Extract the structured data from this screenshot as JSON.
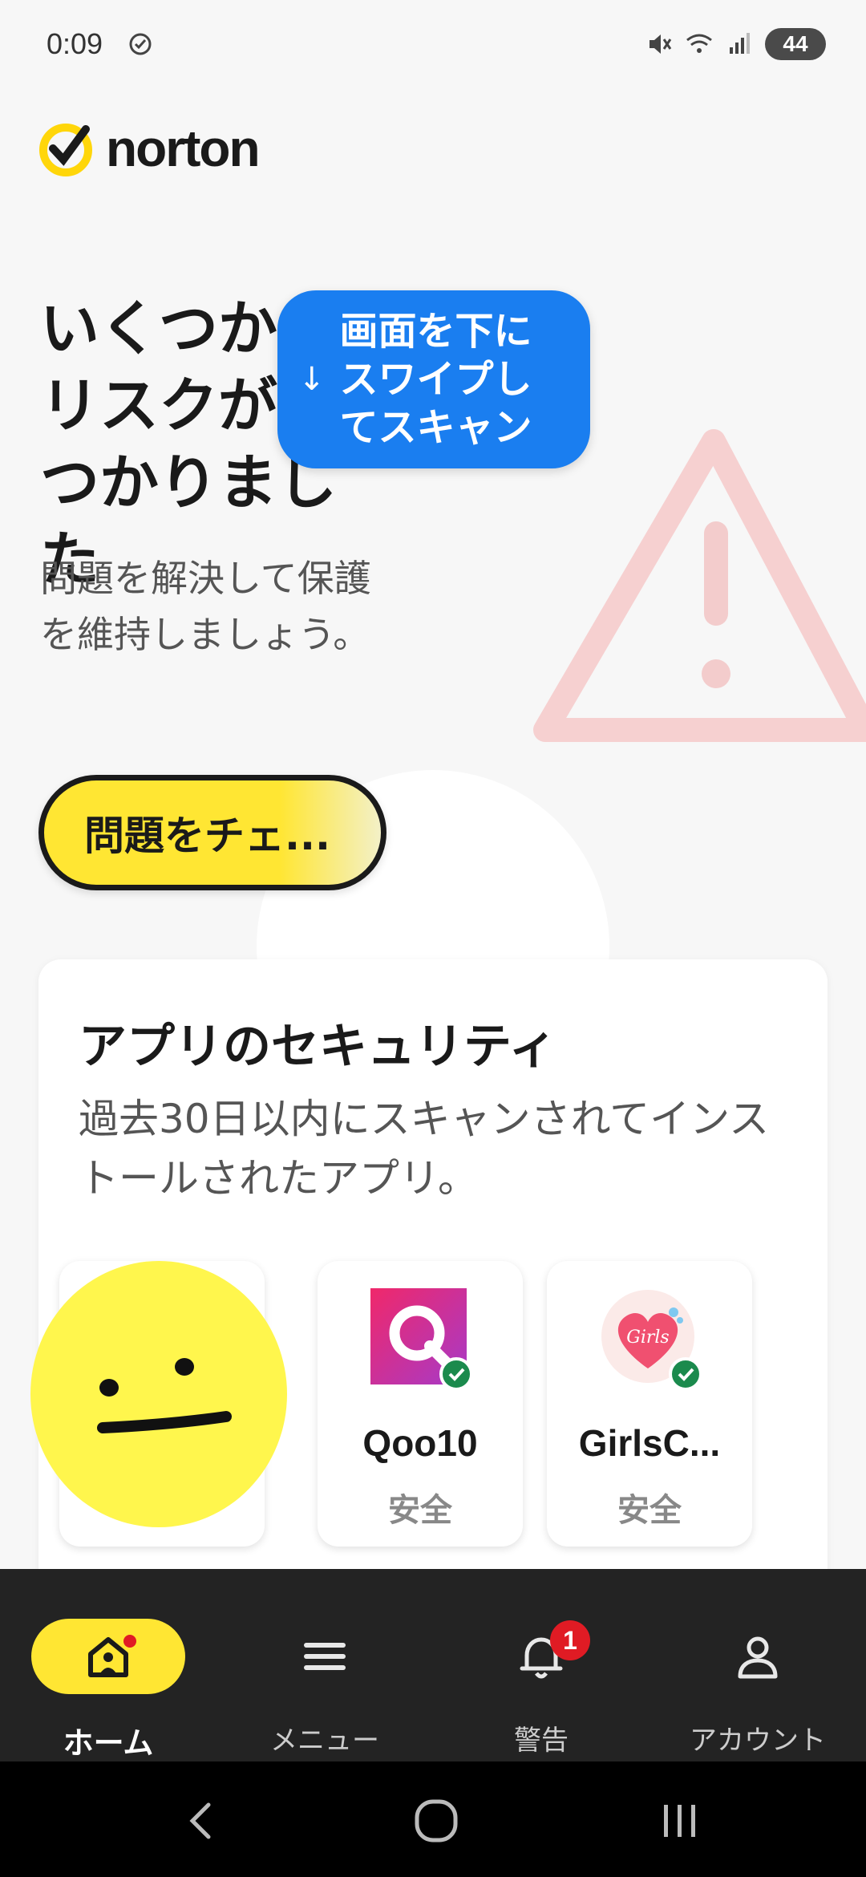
{
  "status_bar": {
    "time": "0:09",
    "battery": "44"
  },
  "brand": {
    "name": "norton"
  },
  "hero": {
    "title": "いくつかのリスクが見つかりました",
    "subtitle": "問題を解決して保護を維持しましょう。",
    "check_button_label": "問題をチェ..."
  },
  "swipe_tooltip": {
    "text": "画面を下に\nスワイプし\nてスキャン"
  },
  "app_security": {
    "title": "アプリのセキュリティ",
    "description": "過去30日以内にスキャンされてインストールされたアプリ。",
    "apps": [
      {
        "name": "Qoo10",
        "status": "安全",
        "icon": "qoo10-app-icon",
        "icon_color": "#e5246f"
      },
      {
        "name": "GirlsC...",
        "status": "安全",
        "icon": "girls-heart-app-icon",
        "icon_color": "#f05070"
      }
    ]
  },
  "bottom_nav": {
    "items": [
      {
        "label": "ホーム",
        "icon": "home-icon",
        "active": true
      },
      {
        "label": "メニュー",
        "icon": "menu-icon",
        "active": false
      },
      {
        "label": "警告",
        "icon": "bell-icon",
        "active": false,
        "badge": "1"
      },
      {
        "label": "アカウント",
        "icon": "account-icon",
        "active": false
      }
    ]
  },
  "colors": {
    "accent_yellow": "#ffe633",
    "tooltip_blue": "#1a7ef0",
    "safe_green": "#1b8a4d",
    "alert_red": "#e01b24"
  }
}
